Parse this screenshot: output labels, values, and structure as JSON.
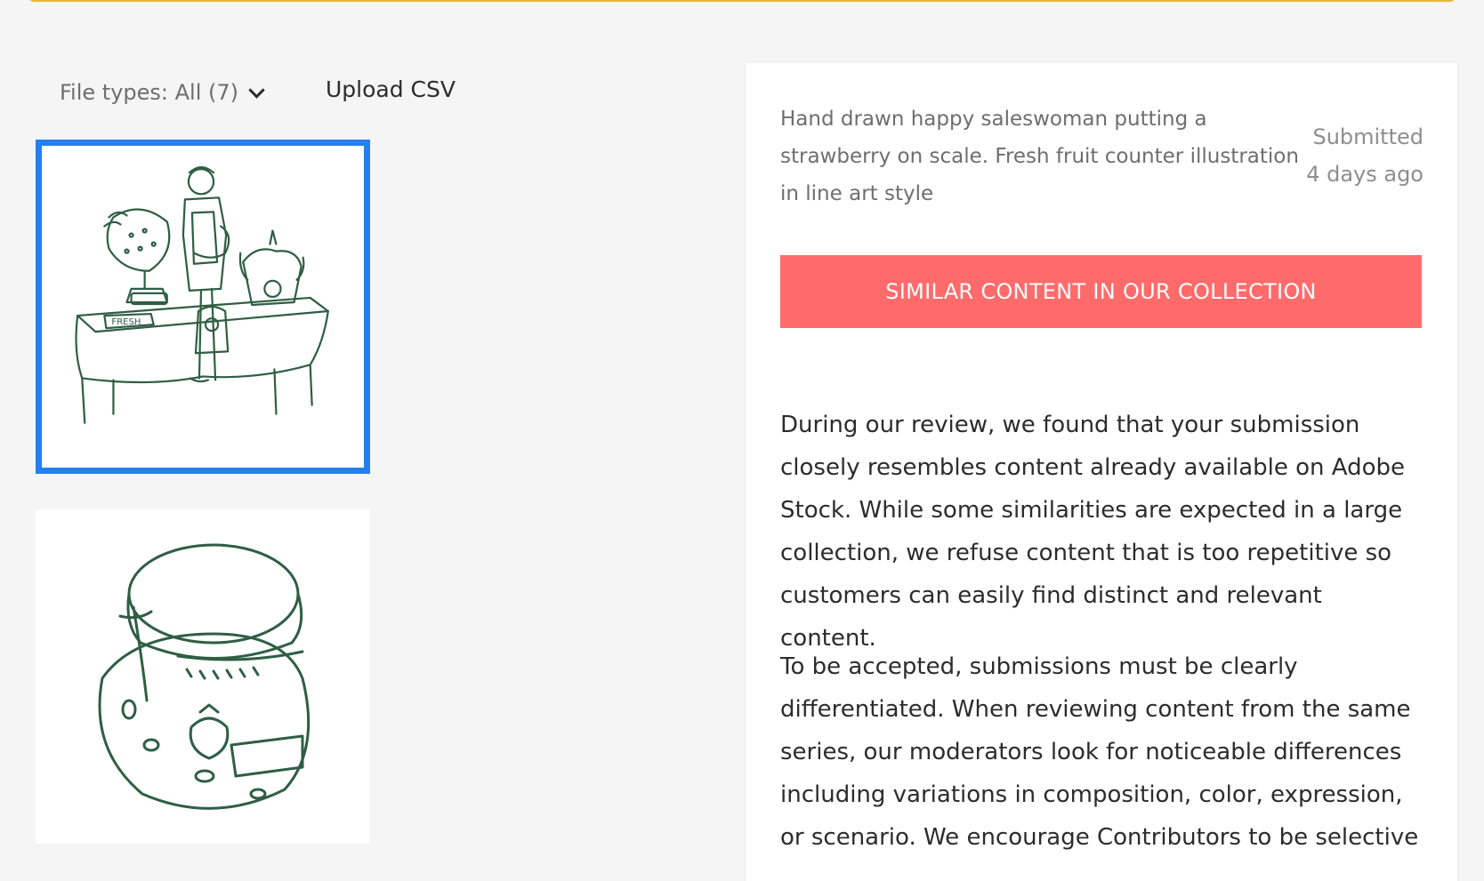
{
  "colors": {
    "accent_selected": "#2680eb",
    "button_bg": "#ff6b6b",
    "top_bar_border": "#e7b93c",
    "illustration_line": "#2f5e44"
  },
  "filters": {
    "file_types_label": "File types: All (7)",
    "chevron_icon": "chevron-down-icon"
  },
  "actions": {
    "upload_csv_label": "Upload CSV"
  },
  "thumbnails": [
    {
      "selected": true,
      "subject": "saleswoman-strawberry-scale-illustration",
      "label_text": "FRESH"
    },
    {
      "selected": false,
      "subject": "jar-strawberry-jam-illustration"
    }
  ],
  "detail": {
    "description": "Hand drawn happy saleswoman putting a strawberry on scale. Fresh fruit counter illustration in line art style",
    "submitted_label": "Submitted",
    "submitted_ago": "4 days ago",
    "similar_button_label": "SIMILAR CONTENT IN OUR COLLECTION",
    "paragraph_1": "During our review, we found that your submission closely resembles content already available on Adobe Stock. While some similarities are expected in a large collection, we refuse content that is too repetitive so customers can easily find distinct and relevant content.",
    "paragraph_2": "To be accepted, submissions must be clearly differentiated. When reviewing content from the same series, our moderators look for noticeable differences including variations in composition, color, expression, or scenario. We encourage Contributors to be selective"
  }
}
